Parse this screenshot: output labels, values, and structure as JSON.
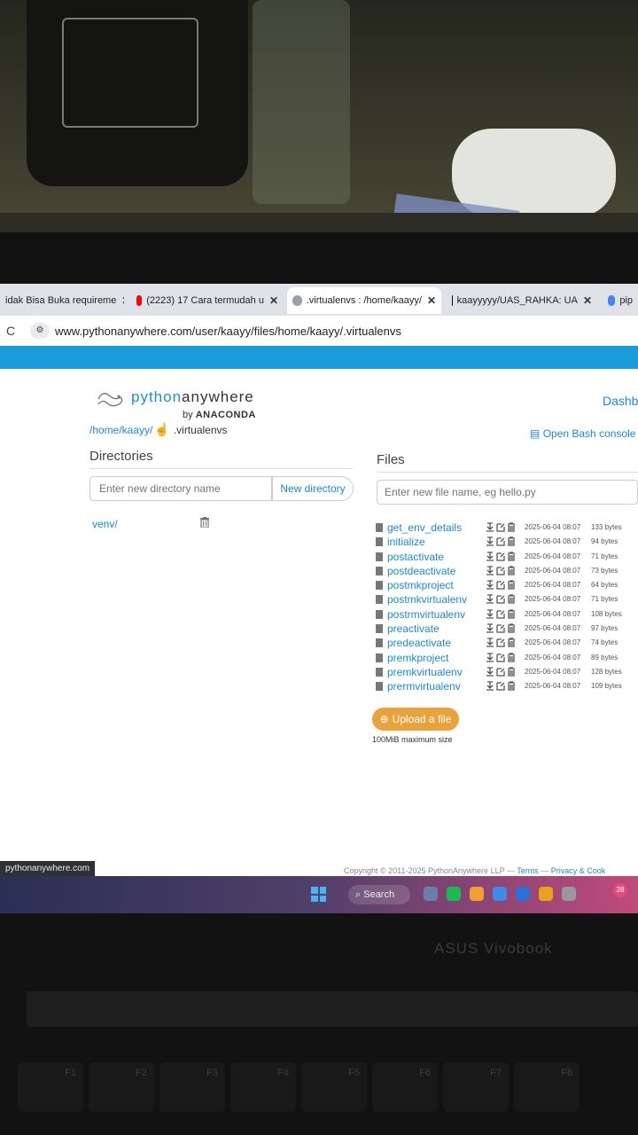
{
  "browser": {
    "tabs": [
      {
        "title": "idak Bisa Buka requireme",
        "close": "✕",
        "icon_color": "#4a8af4"
      },
      {
        "title": "(2223) 17 Cara termudah u",
        "close": "✕",
        "icon_color": "#ff0000"
      },
      {
        "title": ".virtualenvs : /home/kaayy/",
        "close": "✕",
        "icon_color": "#9aa0a6"
      },
      {
        "title": "kaayyyyy/UAS_RAHKA: UA",
        "close": "✕",
        "icon_color": "#111111"
      },
      {
        "title": "pip",
        "close": "",
        "icon_color": "#4285f4"
      }
    ],
    "url": "www.pythonanywhere.com/user/kaayy/files/home/kaayy/.virtualenvs",
    "reload_icon": "C"
  },
  "header": {
    "logo_python": "python",
    "logo_anywhere": "anywhere",
    "logo_by": "by",
    "logo_anaconda": "ANACONDA",
    "dashboard": "Dashb"
  },
  "breadcrumb": {
    "home": "/home/kaayy/",
    "current": ".virtualenvs"
  },
  "bash_link": "Open Bash console h",
  "directories": {
    "heading": "Directories",
    "input_placeholder": "Enter new directory name",
    "button": "New directory",
    "items": [
      {
        "name": "venv/"
      }
    ]
  },
  "files": {
    "heading": "Files",
    "input_placeholder": "Enter new file name, eg hello.py",
    "items": [
      {
        "name": "get_env_details",
        "date": "2025-06-04 08:07",
        "size": "133 bytes"
      },
      {
        "name": "initialize",
        "date": "2025-06-04 08:07",
        "size": "94 bytes"
      },
      {
        "name": "postactivate",
        "date": "2025-06-04 08:07",
        "size": "71 bytes"
      },
      {
        "name": "postdeactivate",
        "date": "2025-06-04 08:07",
        "size": "73 bytes"
      },
      {
        "name": "postmkproject",
        "date": "2025-06-04 08:07",
        "size": "64 bytes"
      },
      {
        "name": "postmkvirtualenv",
        "date": "2025-06-04 08:07",
        "size": "71 bytes"
      },
      {
        "name": "postrmvirtualenv",
        "date": "2025-06-04 08:07",
        "size": "108 bytes"
      },
      {
        "name": "preactivate",
        "date": "2025-06-04 08:07",
        "size": "97 bytes"
      },
      {
        "name": "predeactivate",
        "date": "2025-06-04 08:07",
        "size": "74 bytes"
      },
      {
        "name": "premkproject",
        "date": "2025-06-04 08:07",
        "size": "89 bytes"
      },
      {
        "name": "premkvirtualenv",
        "date": "2025-06-04 08:07",
        "size": "128 bytes"
      },
      {
        "name": "prermvirtualenv",
        "date": "2025-06-04 08:07",
        "size": "109 bytes"
      }
    ],
    "upload_button": "Upload a file",
    "upload_note": "100MiB maximum size"
  },
  "status_url": "pythonanywhere.com",
  "footer": {
    "copyright": "Copyright © 2011-2025 PythonAnywhere LLP",
    "sep1": " — ",
    "terms": "Terms",
    "sep2": " — ",
    "privacy": "Privacy & Cook"
  },
  "taskbar": {
    "search": "Search",
    "notification_count": "28",
    "app_icon_colors": [
      "#6b7ea8",
      "#1db954",
      "#f0a030",
      "#3c8ce8",
      "#2d6fd6",
      "#e9a21b",
      "#999999"
    ]
  },
  "laptop": {
    "brand": "ASUS Vivobook",
    "keys": [
      "F1",
      "F2",
      "F3",
      "F4",
      "F5",
      "F6",
      "F7",
      "F8"
    ]
  },
  "colors": {
    "link": "#1a8ad4",
    "accent_bar": "#1a9bdb",
    "upload": "#e8a33d"
  }
}
